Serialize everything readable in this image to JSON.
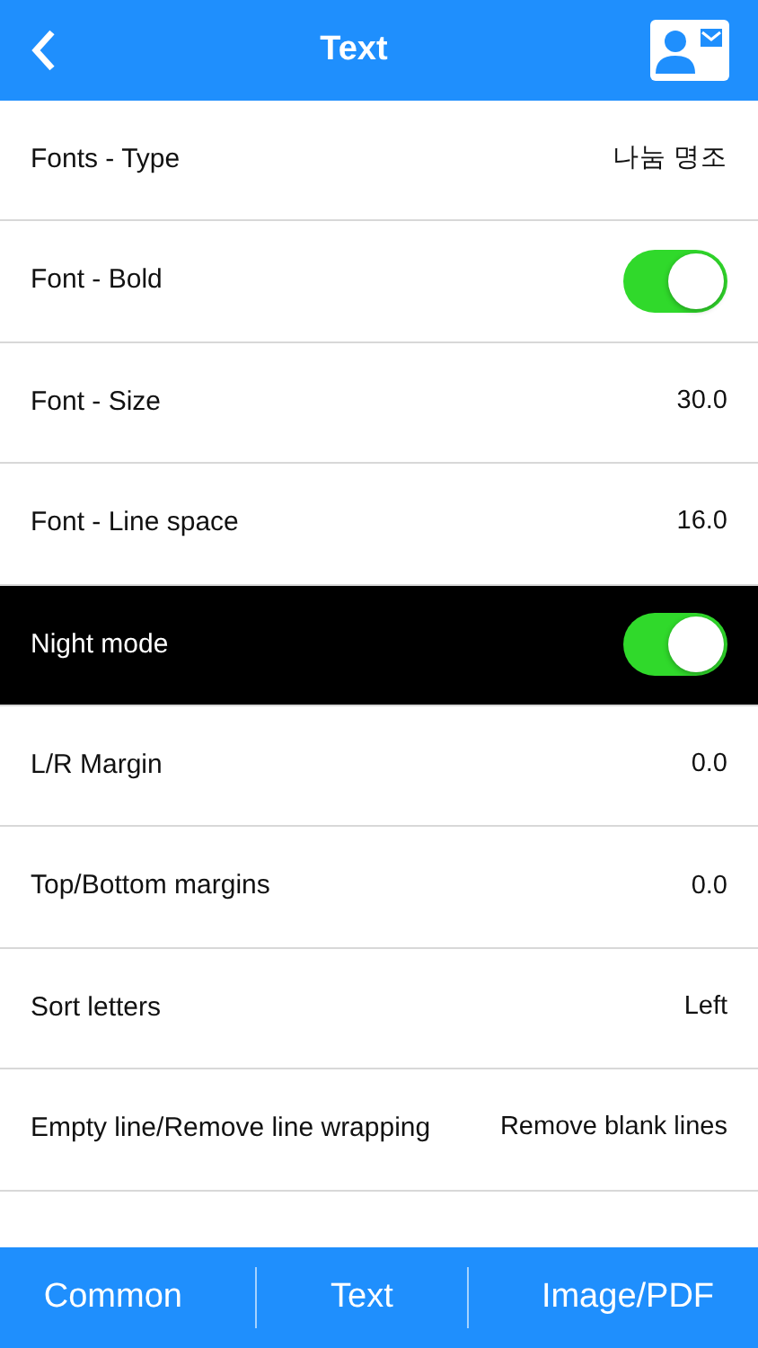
{
  "header": {
    "title": "Text"
  },
  "rows": [
    {
      "kind": "value",
      "label": "Fonts - Type",
      "value": "나눔 명조",
      "dark": false
    },
    {
      "kind": "toggle",
      "label": "Font - Bold",
      "on": true,
      "dark": false
    },
    {
      "kind": "value",
      "label": "Font - Size",
      "value": "30.0",
      "dark": false
    },
    {
      "kind": "value",
      "label": "Font - Line space",
      "value": "16.0",
      "dark": false
    },
    {
      "kind": "toggle",
      "label": "Night mode",
      "on": true,
      "dark": true
    },
    {
      "kind": "value",
      "label": "L/R Margin",
      "value": "0.0",
      "dark": false
    },
    {
      "kind": "value",
      "label": "Top/Bottom margins",
      "value": "0.0",
      "dark": false
    },
    {
      "kind": "value",
      "label": "Sort letters",
      "value": "Left",
      "dark": false
    },
    {
      "kind": "value",
      "label": "Empty line/Remove line wrapping",
      "value": "Remove blank lines",
      "dark": false
    }
  ],
  "tabs": [
    "Common",
    "Text",
    "Image/PDF"
  ]
}
